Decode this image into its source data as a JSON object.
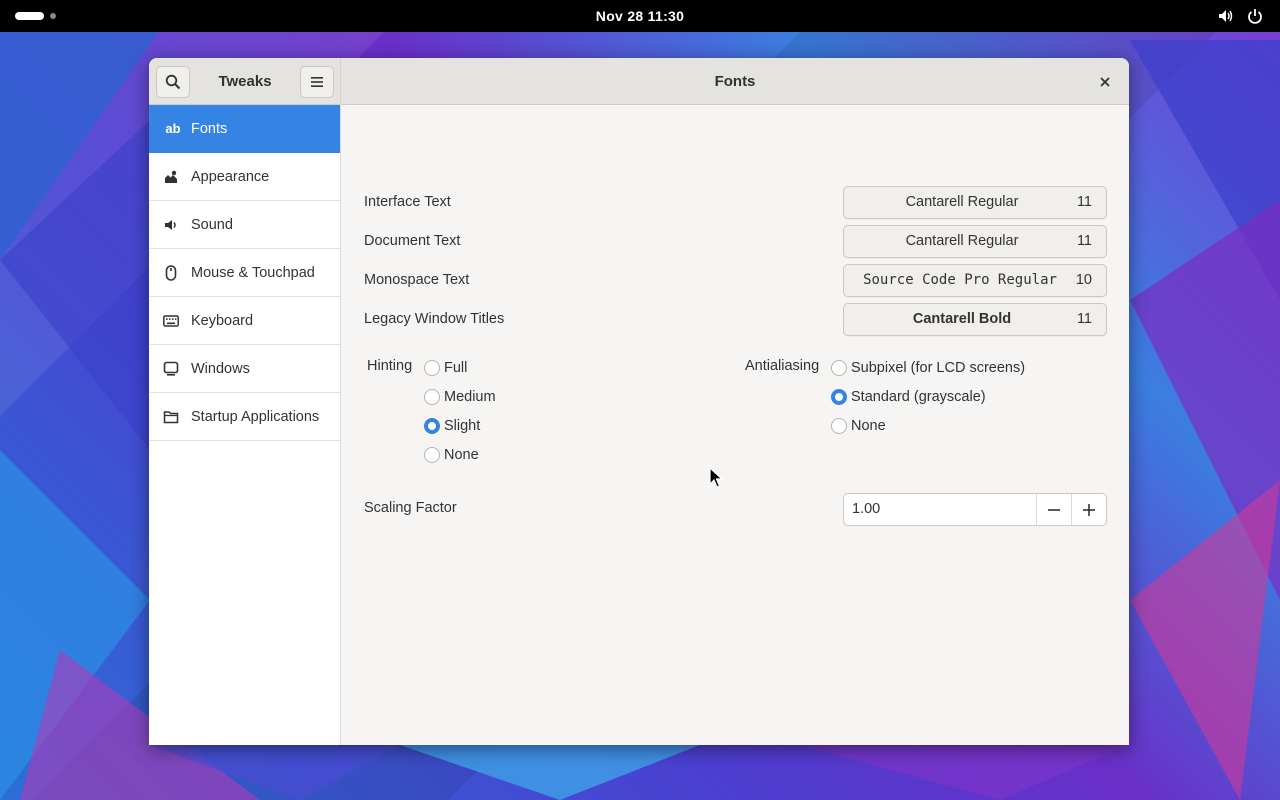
{
  "topbar": {
    "clock": "Nov 28  11:30",
    "icons": [
      "activities-indicator",
      "volume-icon",
      "power-icon"
    ]
  },
  "window": {
    "sidebar_title": "Tweaks",
    "page_title": "Fonts",
    "close_label": "×"
  },
  "sidebar": {
    "items": [
      {
        "label": "Fonts",
        "icon": "font-icon",
        "icon_text": "ab",
        "active": true
      },
      {
        "label": "Appearance",
        "icon": "appearance-icon"
      },
      {
        "label": "Sound",
        "icon": "speaker-icon"
      },
      {
        "label": "Mouse & Touchpad",
        "icon": "mouse-icon"
      },
      {
        "label": "Keyboard",
        "icon": "keyboard-icon"
      },
      {
        "label": "Windows",
        "icon": "window-icon"
      },
      {
        "label": "Startup Applications",
        "icon": "folder-icon"
      }
    ]
  },
  "fonts": {
    "rows": [
      {
        "label": "Interface Text",
        "font": "Cantarell Regular",
        "size": "11"
      },
      {
        "label": "Document Text",
        "font": "Cantarell Regular",
        "size": "11"
      },
      {
        "label": "Monospace Text",
        "font": "Source Code Pro Regular",
        "size": "10"
      },
      {
        "label": "Legacy Window Titles",
        "font": "Cantarell Bold",
        "size": "11"
      }
    ]
  },
  "hinting": {
    "label": "Hinting",
    "options": [
      "Full",
      "Medium",
      "Slight",
      "None"
    ],
    "selected": "Slight"
  },
  "antialiasing": {
    "label": "Antialiasing",
    "options": [
      "Subpixel (for LCD screens)",
      "Standard (grayscale)",
      "None"
    ],
    "selected": "Standard (grayscale)"
  },
  "scaling": {
    "label": "Scaling Factor",
    "value": "1.00"
  },
  "colors": {
    "accent": "#3584e4",
    "window_bg": "#f6f5f4",
    "topbar_bg": "#000000"
  }
}
